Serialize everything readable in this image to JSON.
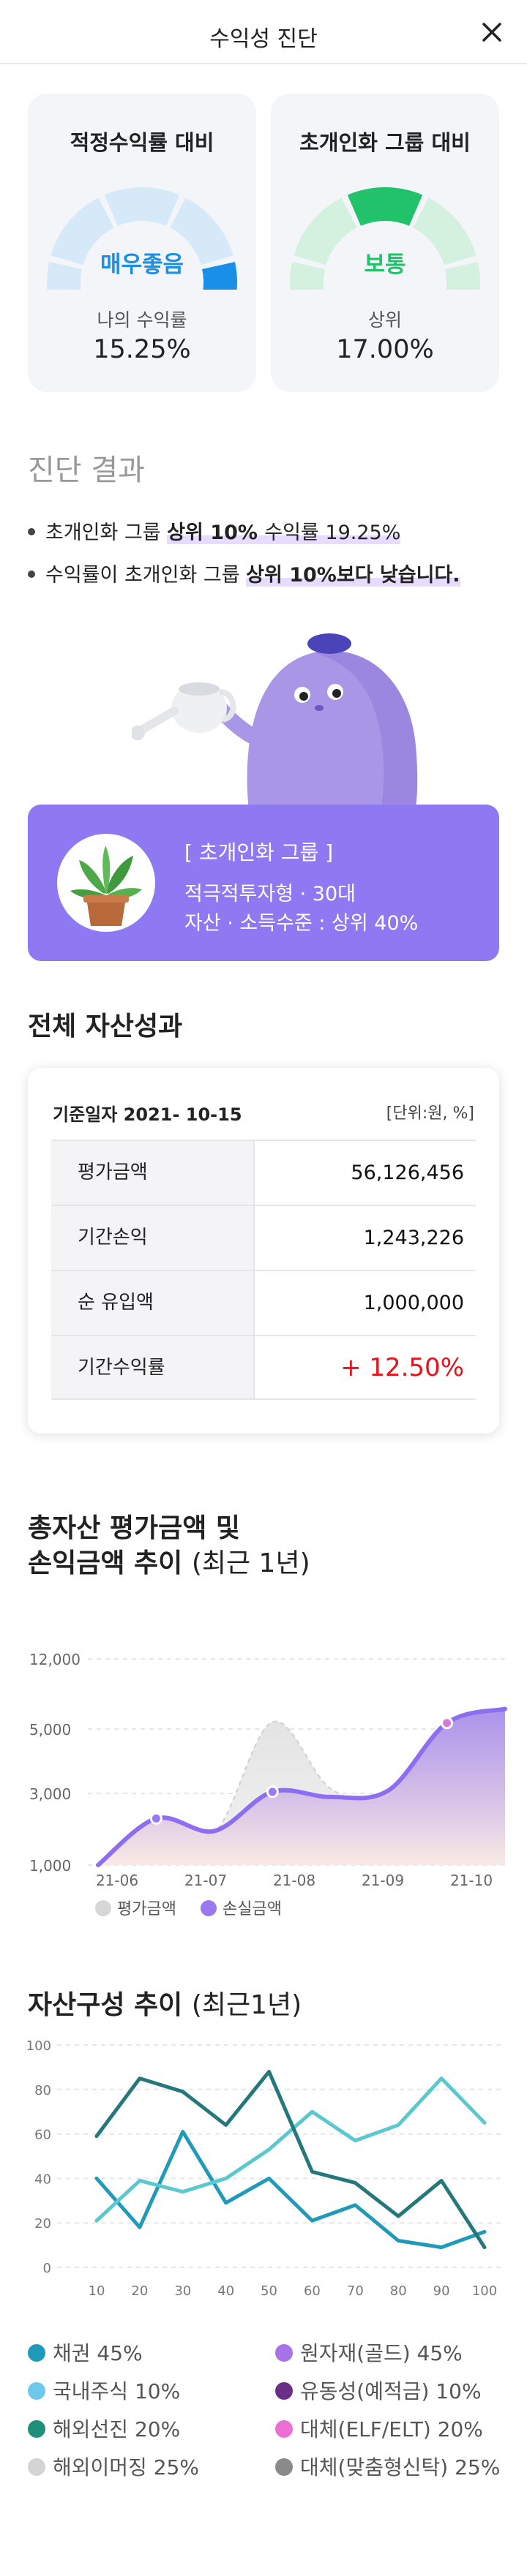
{
  "header": {
    "title": "수익성 진단"
  },
  "gauges": [
    {
      "title": "적정수익률 대비",
      "level": "매우좋음",
      "level_color": "#1a8fe8",
      "sub_label": "나의 수익률",
      "sub_value": "15.25%",
      "active_segment": 4
    },
    {
      "title": "초개인화 그룹 대비",
      "level": "보통",
      "level_color": "#21c26a",
      "sub_label": "상위",
      "sub_value": "17.00%",
      "active_segment": 2
    }
  ],
  "diagnosis": {
    "title": "진단 결과",
    "line1": {
      "pre": "초개인화 그룹 ",
      "highlight": "상위 10% ",
      "post": "수익률 19.25%"
    },
    "line2": {
      "pre": "수익률이 초개인화 그룹 ",
      "highlight": "상위 10%보다 낮습니다."
    }
  },
  "group_card": {
    "title": "[ 초개인화 그룹 ]",
    "line1": "적극적투자형  ·  30대",
    "line2": "자산 · 소득수준 : 상위 40%"
  },
  "performance": {
    "title": "전체 자산성과",
    "date_label": "기준일자  2021- 10-15",
    "unit": "[단위:원, %]",
    "rows": [
      {
        "label": "평가금액",
        "value": "56,126,456"
      },
      {
        "label": "기간손익",
        "value": "1,243,226"
      },
      {
        "label": "순 유입액",
        "value": "1,000,000"
      },
      {
        "label": "기간수익률",
        "value": "+ 12.50%"
      }
    ]
  },
  "trend": {
    "title_bold_1": "총자산 평가금액 및",
    "title_bold_2": "손익금액 추이",
    "title_normal_2": "(최근 1년)",
    "legend": [
      "평가금액",
      "손실금액"
    ],
    "chart_data": {
      "type": "area",
      "x": [
        "21-06",
        "21-07",
        "21-08",
        "21-09",
        "21-10"
      ],
      "y_ticks": [
        "1,000",
        "3,000",
        "5,000",
        "12,000"
      ],
      "series": [
        {
          "name": "평가금액",
          "color": "#d6d6d6",
          "values": [
            1000,
            2300,
            1900,
            5700,
            3150,
            2900,
            5600,
            7000
          ]
        },
        {
          "name": "손실금액",
          "color": "#9a79ee",
          "values": [
            1000,
            2300,
            1950,
            3050,
            2900,
            3100,
            5600,
            7000
          ]
        }
      ]
    }
  },
  "composition": {
    "title_bold": "자산구성 추이",
    "title_normal": "(최근1년)",
    "chart_data": {
      "type": "line",
      "x": [
        10,
        20,
        30,
        40,
        50,
        60,
        70,
        80,
        90,
        100
      ],
      "y_ticks": [
        0,
        20,
        40,
        60,
        80,
        100
      ],
      "series": [
        {
          "color": "#1f9ab8",
          "values": [
            40,
            18,
            61,
            29,
            40,
            21,
            28,
            12,
            9,
            16
          ]
        },
        {
          "color": "#5bc8cf",
          "values": [
            21,
            39,
            34,
            40,
            53,
            70,
            57,
            64,
            85,
            65
          ]
        },
        {
          "color": "#24787c",
          "values": [
            59,
            85,
            79,
            64,
            88,
            43,
            38,
            23,
            39,
            9
          ]
        }
      ]
    },
    "legend": [
      {
        "label": "채권 45%",
        "color": "#1f9ab8"
      },
      {
        "label": "원자재(골드) 45%",
        "color": "#a873e8"
      },
      {
        "label": "국내주식 10%",
        "color": "#6ec8ec"
      },
      {
        "label": "유동성(예적금) 10%",
        "color": "#6b2f8a"
      },
      {
        "label": "해외선진 20%",
        "color": "#1d8f7a"
      },
      {
        "label": "대체(ELF/ELT) 20%",
        "color": "#ee6fd3"
      },
      {
        "label": "해외이머징 25%",
        "color": "#d4d4d4"
      },
      {
        "label": "대체(맞춤형신탁) 25%",
        "color": "#8a8a8a"
      }
    ]
  }
}
